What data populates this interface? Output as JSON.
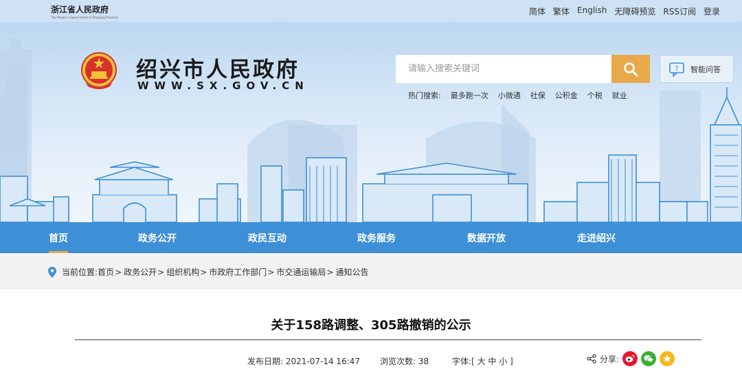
{
  "topbar": {
    "province_cn": "浙江省人民政府",
    "province_en": "The People's Government of Zhejiang Province",
    "links": [
      "简体",
      "繁体",
      "English",
      "无障碍预览",
      "RSS订阅",
      "登录"
    ]
  },
  "header": {
    "site_title": "绍兴市人民政府",
    "site_url": "WWW.SX.GOV.CN",
    "search_placeholder": "请输入搜索关键词",
    "hot_label": "热门搜索:",
    "hot_terms": [
      "最多跑一次",
      "小微通",
      "社保",
      "公积金",
      "个税",
      "就业"
    ],
    "smart_qa": "智能问答"
  },
  "nav": {
    "items": [
      "首页",
      "政务公开",
      "政民互动",
      "政务服务",
      "数据开放",
      "走进绍兴"
    ],
    "active_index": 0
  },
  "breadcrumb": {
    "label": "当前位置:",
    "items": [
      "首页",
      "政务公开",
      "组织机构",
      "市政府工作部门",
      "市交通运输局",
      "通知公告"
    ]
  },
  "article": {
    "title": "关于158路调整、305路撤销的公示",
    "publish_date_label": "发布日期:",
    "publish_date": "2021-07-14 16:47",
    "views_label": "浏览次数:",
    "views": "38",
    "font_label": "字体:[",
    "font_sizes": [
      "大",
      "中",
      "小"
    ],
    "font_close": "]",
    "share_label": "分享:"
  },
  "colors": {
    "nav_blue": "#3d8fd6",
    "accent_orange": "#e9a84a",
    "weibo": "#e6162d",
    "wechat": "#3cb034",
    "qzone": "#f2b91c"
  },
  "icons": [
    "search-icon",
    "chat-help-icon",
    "location-pin-icon",
    "share-icon",
    "weibo-icon",
    "wechat-icon",
    "qzone-icon",
    "national-emblem"
  ]
}
